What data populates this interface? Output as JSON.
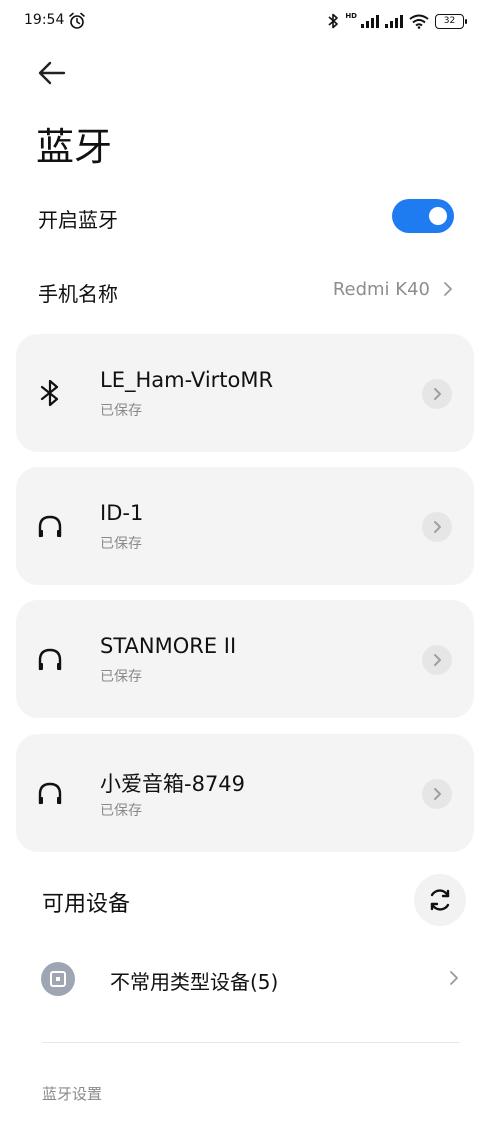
{
  "status_bar": {
    "time": "19:54",
    "hd_label": "HD",
    "battery_level": "32"
  },
  "header": {
    "title": "蓝牙"
  },
  "bluetooth_toggle": {
    "label": "开启蓝牙",
    "enabled": true,
    "accent_color": "#1f7cf0"
  },
  "phone_name": {
    "label": "手机名称",
    "value": "Redmi K40"
  },
  "paired_devices": [
    {
      "name": "LE_Ham-VirtoMR",
      "status": "已保存",
      "icon": "bluetooth-icon"
    },
    {
      "name": "ID-1",
      "status": "已保存",
      "icon": "headphones-icon"
    },
    {
      "name": "STANMORE II",
      "status": "已保存",
      "icon": "headphones-icon"
    },
    {
      "name": "小爱音箱-8749",
      "status": "已保存",
      "icon": "headphones-icon"
    }
  ],
  "available": {
    "title": "可用设备",
    "uncommon_label": "不常用类型设备(5)"
  },
  "footer": {
    "settings_label": "蓝牙设置"
  }
}
